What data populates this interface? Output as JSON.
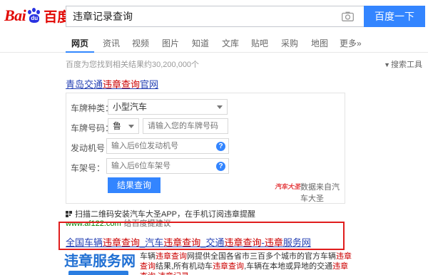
{
  "header": {
    "logo": {
      "bai": "Bai",
      "du": "du",
      "cn": "百度"
    },
    "search_value": "违章记录查询",
    "search_button": "百度一下"
  },
  "tabs": [
    "网页",
    "资讯",
    "视频",
    "图片",
    "知道",
    "文库",
    "贴吧",
    "采购",
    "地图",
    "更多»"
  ],
  "meta": {
    "result_count": "百度为您找到相关结果约30,200,000个",
    "search_tools": "搜索工具"
  },
  "result1": {
    "title_a": "青岛交通",
    "title_hl": "违章查询",
    "title_b": "官网",
    "form": {
      "plate_type_label": "车牌种类：",
      "plate_type_value": "小型汽车",
      "plate_no_label": "车牌号码：",
      "plate_prefix": "鲁",
      "plate_no_placeholder": "请输入您的车牌号码",
      "engine_label": "发动机号：",
      "engine_placeholder": "输入后6位发动机号",
      "frame_label": "车架号：",
      "frame_placeholder": "输入后6位车架号",
      "help": "?",
      "query_button": "结果查询"
    },
    "brand_mark": "汽车大圣",
    "brand_text": "数据来自汽车大圣"
  },
  "qr_line": "扫描二维码安装汽车大圣APP，在手机订阅违章提醒",
  "url_line": {
    "url": "www.af122.com",
    "feedback": "给百度提建议"
  },
  "result2": {
    "parts": [
      {
        "t": "全国车辆",
        "hl": false
      },
      {
        "t": "违章查询",
        "hl": true
      },
      {
        "t": "_汽车",
        "hl": false
      },
      {
        "t": "违章查询",
        "hl": true
      },
      {
        "t": "_交通",
        "hl": false
      },
      {
        "t": "违章查询",
        "hl": true
      },
      {
        "t": "-",
        "hl": false
      },
      {
        "t": "违章",
        "hl": true
      },
      {
        "t": "服务网",
        "hl": false
      }
    ]
  },
  "result3": {
    "thumb_text": "违章服务网",
    "snippet": [
      {
        "t": "车辆",
        "hl": false
      },
      {
        "t": "违章查询",
        "hl": true
      },
      {
        "t": "网提供全国各省市三百多个城市的官方车辆",
        "hl": false
      },
      {
        "t": "违章查询",
        "hl": true
      },
      {
        "t": "结果,所有机动车",
        "hl": false
      },
      {
        "t": "违章查询",
        "hl": true
      },
      {
        "t": ",车辆在本地或异地的交通",
        "hl": false
      },
      {
        "t": "违章查询",
        "hl": true
      },
      {
        "t": ",",
        "hl": false
      },
      {
        "t": "违章记录",
        "hl": true
      }
    ]
  },
  "colors": {
    "accent": "#3385ff",
    "link": "#2440b3",
    "highlight": "#c00",
    "url": "#008000",
    "red_box": "#e01d1d"
  }
}
